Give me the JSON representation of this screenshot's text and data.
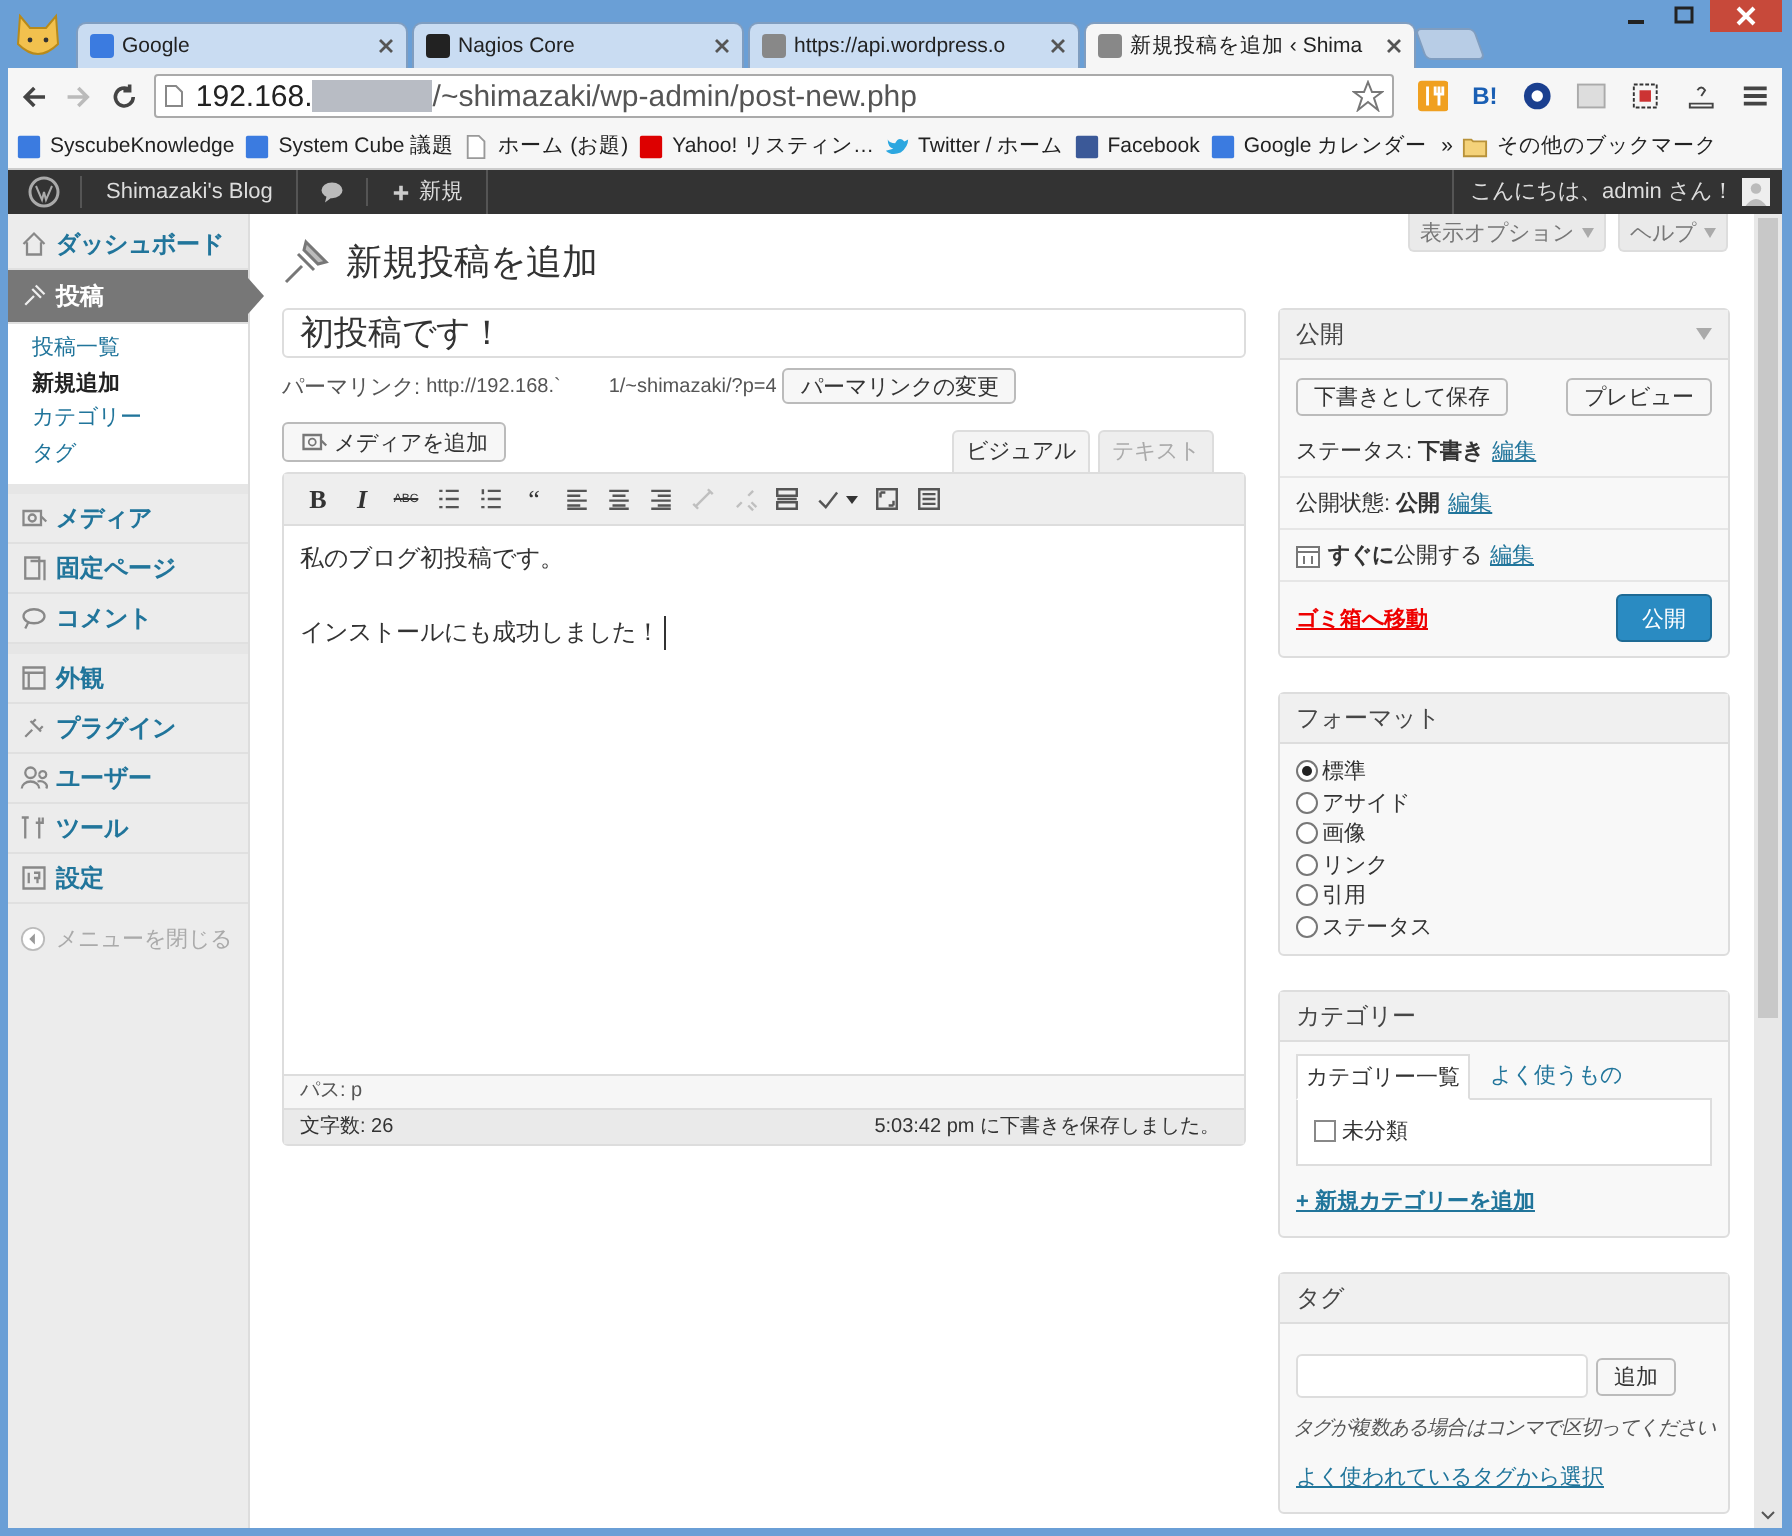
{
  "browser": {
    "tabs": [
      {
        "title": "Google",
        "selected": false
      },
      {
        "title": "Nagios Core",
        "selected": false
      },
      {
        "title": "https://api.wordpress.o",
        "selected": false
      },
      {
        "title": "新規投稿を追加 ‹ Shima",
        "selected": true
      }
    ],
    "url_start": "192.168.",
    "url_end": "/~shimazaki/wp-admin/post-new.php",
    "ext_label": "B!",
    "bookmarks": [
      "SyscubeKnowledge",
      "System Cube 議題",
      "ホーム (お題)",
      "Yahoo! リスティン…",
      "Twitter / ホーム",
      "Facebook",
      "Google カレンダー"
    ],
    "bookmarks_more": "»",
    "other_bookmarks": "その他のブックマーク"
  },
  "admin_bar": {
    "site": "Shimazaki's Blog",
    "new_label": "新規",
    "greeting": "こんにちは、admin さん！"
  },
  "sidebar": {
    "items": [
      {
        "label": "ダッシュボード",
        "selected": false
      },
      {
        "label": "投稿",
        "selected": true,
        "children": [
          {
            "label": "投稿一覧",
            "selected": false
          },
          {
            "label": "新規追加",
            "selected": true
          },
          {
            "label": "カテゴリー",
            "selected": false
          },
          {
            "label": "タグ",
            "selected": false
          }
        ]
      },
      {
        "label": "メディア",
        "selected": false
      },
      {
        "label": "固定ページ",
        "selected": false
      },
      {
        "label": "コメント",
        "selected": false
      },
      {
        "label": "外観",
        "selected": false
      },
      {
        "label": "プラグイン",
        "selected": false
      },
      {
        "label": "ユーザー",
        "selected": false
      },
      {
        "label": "ツール",
        "selected": false
      },
      {
        "label": "設定",
        "selected": false
      }
    ],
    "collapse": "メニューを閉じる"
  },
  "screen_options": "表示オプション",
  "help": "ヘルプ",
  "page_title": "新規投稿を追加",
  "post_title": "初投稿です！",
  "permalink": {
    "label": "パーマリンク:",
    "url_start": "http://192.168.`",
    "url_end": "1/~shimazaki/?p=4",
    "button": "パーマリンクの変更"
  },
  "add_media": "メディアを追加",
  "editor_tabs": [
    {
      "label": "ビジュアル",
      "selected": true
    },
    {
      "label": "テキスト",
      "selected": false
    }
  ],
  "toolbar": [
    {
      "kind": "text",
      "label": "B",
      "disabled": false
    },
    {
      "kind": "italic",
      "label": "I",
      "disabled": false
    },
    {
      "kind": "strike",
      "label": "ABC",
      "disabled": false
    },
    {
      "kind": "icon",
      "disabled": false
    },
    {
      "kind": "icon",
      "disabled": false
    },
    {
      "kind": "text",
      "label": "“",
      "disabled": false
    },
    {
      "kind": "icon",
      "disabled": false
    },
    {
      "kind": "icon",
      "disabled": false
    },
    {
      "kind": "icon",
      "disabled": false
    },
    {
      "kind": "icon",
      "disabled": true
    },
    {
      "kind": "icon",
      "disabled": true
    },
    {
      "kind": "icon",
      "disabled": false
    },
    {
      "kind": "icon",
      "disabled": false
    },
    {
      "kind": "icon",
      "disabled": false
    },
    {
      "kind": "icon",
      "disabled": false
    }
  ],
  "editor": {
    "paragraphs": [
      "私のブログ初投稿です。",
      "インストールにも成功しました！"
    ],
    "path": "パス: p",
    "word_count": "文字数: 26",
    "saved": "5:03:42 pm に下書きを保存しました。"
  },
  "publish_box": {
    "title": "公開",
    "save_draft": "下書きとして保存",
    "preview": "プレビュー",
    "rows": [
      {
        "text": "ステータス: **下書き**",
        "edit": "編集"
      },
      {
        "text": "公開状態: **公開**",
        "edit": "編集"
      },
      {
        "text": "**すぐに**公開する",
        "edit": "編集"
      }
    ],
    "trash": "ゴミ箱へ移動",
    "publish": "公開"
  },
  "format_box": {
    "title": "フォーマット",
    "options": [
      {
        "label": "標準",
        "selected": true
      },
      {
        "label": "アサイド",
        "selected": false
      },
      {
        "label": "画像",
        "selected": false
      },
      {
        "label": "リンク",
        "selected": false
      },
      {
        "label": "引用",
        "selected": false
      },
      {
        "label": "ステータス",
        "selected": false
      }
    ]
  },
  "category_box": {
    "title": "カテゴリー",
    "tabs": [
      {
        "label": "カテゴリー一覧",
        "selected": true
      },
      {
        "label": "よく使うもの",
        "selected": false
      }
    ],
    "categories": [
      {
        "label": "未分類",
        "checked": false
      }
    ],
    "add_link": "+ 新規カテゴリーを追加"
  },
  "tag_box": {
    "title": "タグ",
    "button": "追加",
    "hint": "タグが複数ある場合はコンマで区切ってください",
    "choose_link": "よく使われているタグから選択"
  }
}
